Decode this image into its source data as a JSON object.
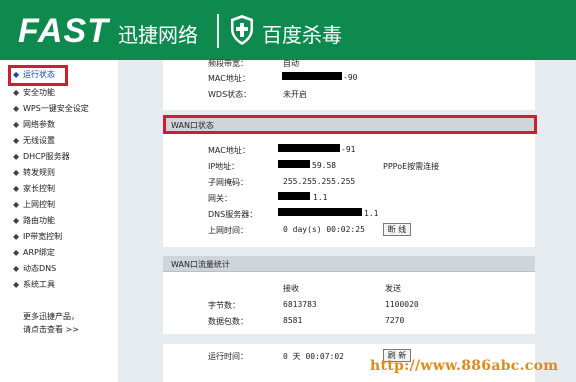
{
  "header": {
    "logo": "FAST",
    "brand_cn": "迅捷网络",
    "antivirus": "百度杀毒"
  },
  "sidebar": {
    "items": [
      {
        "label": "运行状态"
      },
      {
        "label": "安全功能"
      },
      {
        "label": "WPS一键安全设定"
      },
      {
        "label": "网络参数"
      },
      {
        "label": "无线设置"
      },
      {
        "label": "DHCP服务器"
      },
      {
        "label": "转发规则"
      },
      {
        "label": "家长控制"
      },
      {
        "label": "上网控制"
      },
      {
        "label": "路由功能"
      },
      {
        "label": "IP带宽控制"
      },
      {
        "label": "ARP绑定"
      },
      {
        "label": "动态DNS"
      },
      {
        "label": "系统工具"
      }
    ],
    "more_line1": "更多迅捷产品，",
    "more_line2": "请点击查看 >>"
  },
  "wireless": {
    "bandwidth_label": "频段带宽：",
    "bandwidth_value": "自动",
    "mac_label": "MAC地址：",
    "mac_suffix": "-90",
    "wds_label": "WDS状态：",
    "wds_value": "未开启"
  },
  "wan": {
    "title": "WAN口状态",
    "mac_label": "MAC地址：",
    "mac_suffix": "-91",
    "ip_label": "IP地址：",
    "ip_suffix": "59.58",
    "conn_type": "PPPoE按需连接",
    "mask_label": "子网掩码：",
    "mask_value": "255.255.255.255",
    "gateway_label": "网关：",
    "gateway_suffix": "1.1",
    "dns_label": "DNS服务器：",
    "dns_suffix": "1.1",
    "uptime_label": "上网时间：",
    "uptime_value": "0 day(s) 00:02:25",
    "disconnect_button": "断 线"
  },
  "traffic": {
    "title": "WAN口流量统计",
    "col_recv": "接收",
    "col_send": "发送",
    "rows": [
      {
        "label": "字节数：",
        "recv": "6813783",
        "send": "1100020"
      },
      {
        "label": "数据包数：",
        "recv": "8581",
        "send": "7270"
      }
    ]
  },
  "runtime": {
    "label": "运行时间：",
    "value": "0 天 00:07:02",
    "refresh_button": "刷 新"
  },
  "watermark": "http://www.886abc.com",
  "colors": {
    "header_green": "#0f8a4f",
    "highlight_red": "#cc2030",
    "main_bg": "#e6ebf0",
    "active_link": "#1a43b5",
    "watermark": "#e08a1a"
  }
}
